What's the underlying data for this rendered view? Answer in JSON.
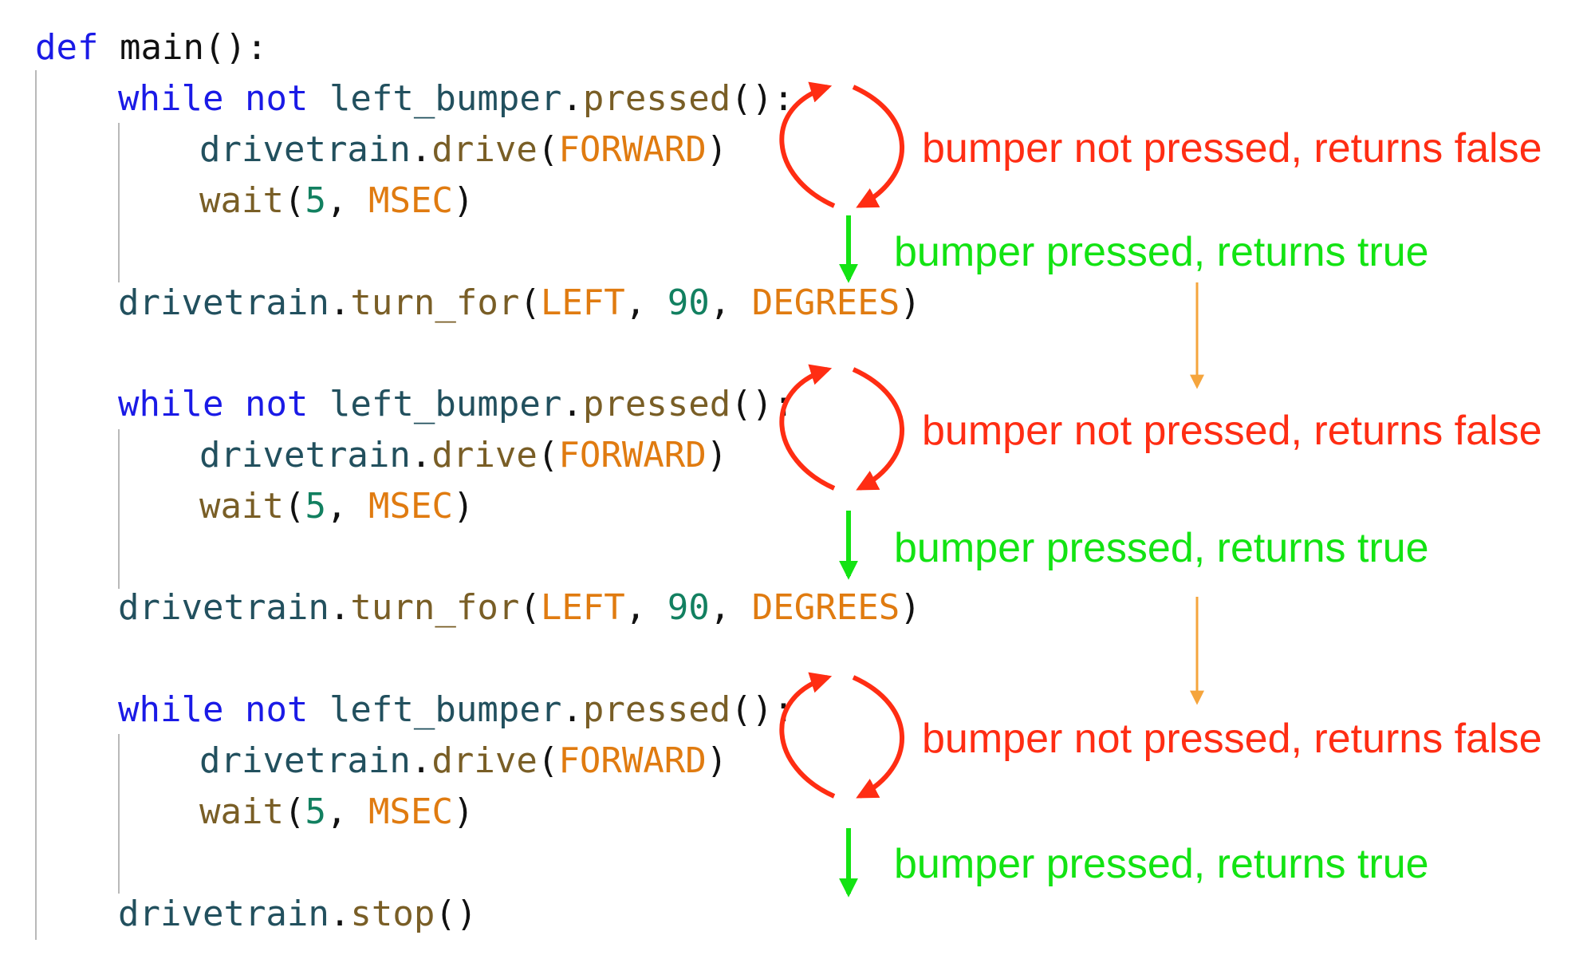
{
  "colors": {
    "keyword": "#1a1ae6",
    "function": "#795e26",
    "variable": "#22505e",
    "constant": "#e07b10",
    "number": "#128060",
    "false_path": "#ff2d13",
    "true_path": "#13e313",
    "flow_arrow": "#f5a53d"
  },
  "code": {
    "def_kw": "def",
    "main_sig": "main():",
    "while_kw": "while",
    "not_kw": "not",
    "bumper_var": "left_bumper",
    "dot": ".",
    "pressed_fn": "pressed",
    "call_colon": "():",
    "drivetrain_var": "drivetrain",
    "drive_fn": "drive",
    "open_paren": "(",
    "close_paren": ")",
    "forward_const": "FORWARD",
    "wait_fn": "wait",
    "five": "5",
    "comma": ",",
    "msec_const": "MSEC",
    "turn_for_fn": "turn_for",
    "left_const": "LEFT",
    "ninety": "90",
    "degrees_const": "DEGREES",
    "stop_fn": "stop",
    "empty_call": "()"
  },
  "annotations": {
    "false_label": "bumper not pressed, returns false",
    "true_label": "bumper pressed, returns true"
  }
}
